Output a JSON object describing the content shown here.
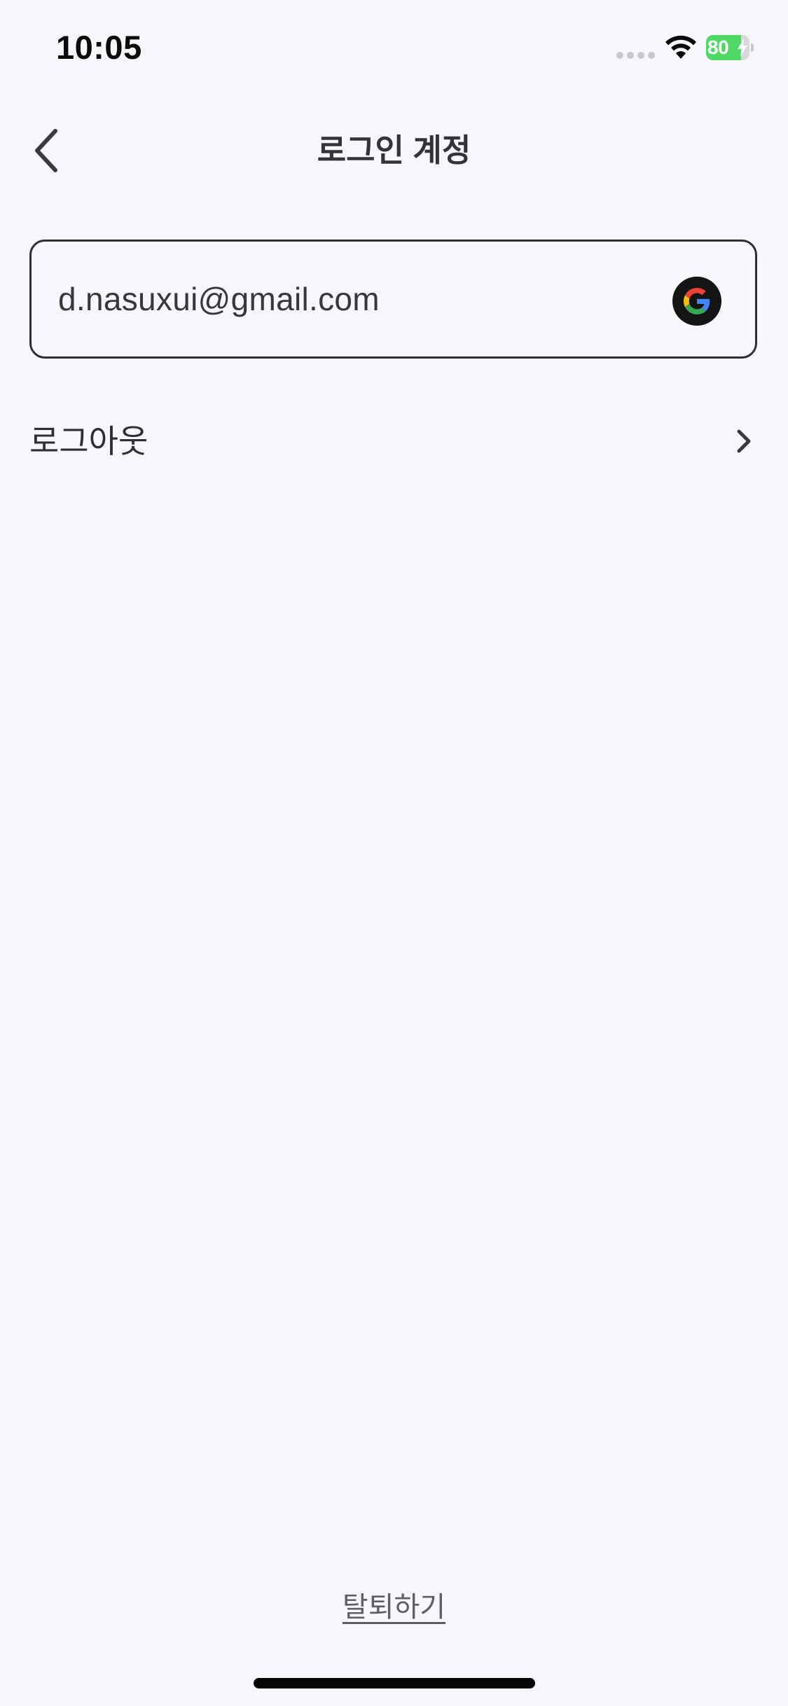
{
  "status_bar": {
    "time": "10:05",
    "battery_level": "80",
    "battery_fraction": 0.8,
    "battery_color": "#4cd964",
    "charging": true,
    "icons": [
      "signal-dots-icon",
      "wifi-icon",
      "battery-icon",
      "charging-bolt-icon"
    ]
  },
  "nav": {
    "title": "로그인 계정",
    "back_icon": "chevron-left-icon"
  },
  "account": {
    "email": "d.nasuxui@gmail.com",
    "provider_icon": "google-icon"
  },
  "menu": {
    "logout_label": "로그아웃",
    "logout_icon": "chevron-right-icon"
  },
  "footer": {
    "withdraw_label": "탈퇴하기"
  },
  "colors": {
    "background": "#f9f6fb",
    "text": "#2f2f33",
    "muted_text": "#5e5e63",
    "border": "#2f2f33",
    "google_badge": "#141414"
  }
}
